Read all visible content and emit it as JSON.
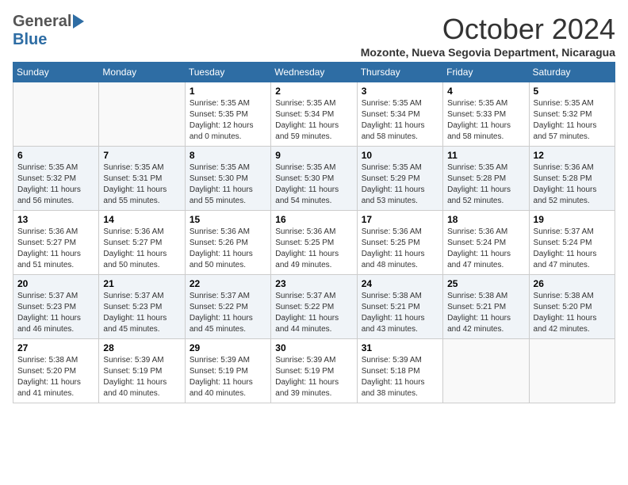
{
  "header": {
    "logo_general": "General",
    "logo_blue": "Blue",
    "month_title": "October 2024",
    "location": "Mozonte, Nueva Segovia Department, Nicaragua"
  },
  "calendar": {
    "days_of_week": [
      "Sunday",
      "Monday",
      "Tuesday",
      "Wednesday",
      "Thursday",
      "Friday",
      "Saturday"
    ],
    "weeks": [
      [
        {
          "day": "",
          "info": ""
        },
        {
          "day": "",
          "info": ""
        },
        {
          "day": "1",
          "info": "Sunrise: 5:35 AM\nSunset: 5:35 PM\nDaylight: 12 hours\nand 0 minutes."
        },
        {
          "day": "2",
          "info": "Sunrise: 5:35 AM\nSunset: 5:34 PM\nDaylight: 11 hours\nand 59 minutes."
        },
        {
          "day": "3",
          "info": "Sunrise: 5:35 AM\nSunset: 5:34 PM\nDaylight: 11 hours\nand 58 minutes."
        },
        {
          "day": "4",
          "info": "Sunrise: 5:35 AM\nSunset: 5:33 PM\nDaylight: 11 hours\nand 58 minutes."
        },
        {
          "day": "5",
          "info": "Sunrise: 5:35 AM\nSunset: 5:32 PM\nDaylight: 11 hours\nand 57 minutes."
        }
      ],
      [
        {
          "day": "6",
          "info": "Sunrise: 5:35 AM\nSunset: 5:32 PM\nDaylight: 11 hours\nand 56 minutes."
        },
        {
          "day": "7",
          "info": "Sunrise: 5:35 AM\nSunset: 5:31 PM\nDaylight: 11 hours\nand 55 minutes."
        },
        {
          "day": "8",
          "info": "Sunrise: 5:35 AM\nSunset: 5:30 PM\nDaylight: 11 hours\nand 55 minutes."
        },
        {
          "day": "9",
          "info": "Sunrise: 5:35 AM\nSunset: 5:30 PM\nDaylight: 11 hours\nand 54 minutes."
        },
        {
          "day": "10",
          "info": "Sunrise: 5:35 AM\nSunset: 5:29 PM\nDaylight: 11 hours\nand 53 minutes."
        },
        {
          "day": "11",
          "info": "Sunrise: 5:35 AM\nSunset: 5:28 PM\nDaylight: 11 hours\nand 52 minutes."
        },
        {
          "day": "12",
          "info": "Sunrise: 5:36 AM\nSunset: 5:28 PM\nDaylight: 11 hours\nand 52 minutes."
        }
      ],
      [
        {
          "day": "13",
          "info": "Sunrise: 5:36 AM\nSunset: 5:27 PM\nDaylight: 11 hours\nand 51 minutes."
        },
        {
          "day": "14",
          "info": "Sunrise: 5:36 AM\nSunset: 5:27 PM\nDaylight: 11 hours\nand 50 minutes."
        },
        {
          "day": "15",
          "info": "Sunrise: 5:36 AM\nSunset: 5:26 PM\nDaylight: 11 hours\nand 50 minutes."
        },
        {
          "day": "16",
          "info": "Sunrise: 5:36 AM\nSunset: 5:25 PM\nDaylight: 11 hours\nand 49 minutes."
        },
        {
          "day": "17",
          "info": "Sunrise: 5:36 AM\nSunset: 5:25 PM\nDaylight: 11 hours\nand 48 minutes."
        },
        {
          "day": "18",
          "info": "Sunrise: 5:36 AM\nSunset: 5:24 PM\nDaylight: 11 hours\nand 47 minutes."
        },
        {
          "day": "19",
          "info": "Sunrise: 5:37 AM\nSunset: 5:24 PM\nDaylight: 11 hours\nand 47 minutes."
        }
      ],
      [
        {
          "day": "20",
          "info": "Sunrise: 5:37 AM\nSunset: 5:23 PM\nDaylight: 11 hours\nand 46 minutes."
        },
        {
          "day": "21",
          "info": "Sunrise: 5:37 AM\nSunset: 5:23 PM\nDaylight: 11 hours\nand 45 minutes."
        },
        {
          "day": "22",
          "info": "Sunrise: 5:37 AM\nSunset: 5:22 PM\nDaylight: 11 hours\nand 45 minutes."
        },
        {
          "day": "23",
          "info": "Sunrise: 5:37 AM\nSunset: 5:22 PM\nDaylight: 11 hours\nand 44 minutes."
        },
        {
          "day": "24",
          "info": "Sunrise: 5:38 AM\nSunset: 5:21 PM\nDaylight: 11 hours\nand 43 minutes."
        },
        {
          "day": "25",
          "info": "Sunrise: 5:38 AM\nSunset: 5:21 PM\nDaylight: 11 hours\nand 42 minutes."
        },
        {
          "day": "26",
          "info": "Sunrise: 5:38 AM\nSunset: 5:20 PM\nDaylight: 11 hours\nand 42 minutes."
        }
      ],
      [
        {
          "day": "27",
          "info": "Sunrise: 5:38 AM\nSunset: 5:20 PM\nDaylight: 11 hours\nand 41 minutes."
        },
        {
          "day": "28",
          "info": "Sunrise: 5:39 AM\nSunset: 5:19 PM\nDaylight: 11 hours\nand 40 minutes."
        },
        {
          "day": "29",
          "info": "Sunrise: 5:39 AM\nSunset: 5:19 PM\nDaylight: 11 hours\nand 40 minutes."
        },
        {
          "day": "30",
          "info": "Sunrise: 5:39 AM\nSunset: 5:19 PM\nDaylight: 11 hours\nand 39 minutes."
        },
        {
          "day": "31",
          "info": "Sunrise: 5:39 AM\nSunset: 5:18 PM\nDaylight: 11 hours\nand 38 minutes."
        },
        {
          "day": "",
          "info": ""
        },
        {
          "day": "",
          "info": ""
        }
      ]
    ]
  }
}
